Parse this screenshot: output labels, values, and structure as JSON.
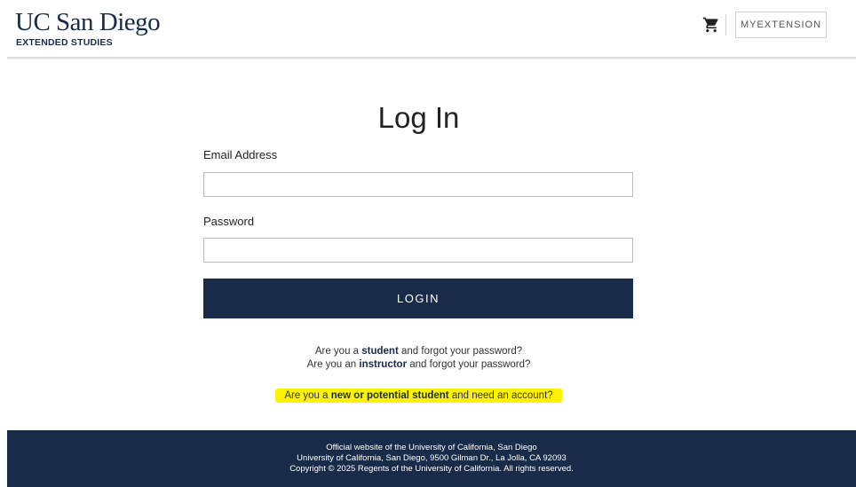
{
  "header": {
    "logo_main": "UC San Diego",
    "logo_sub": "EXTENDED STUDIES",
    "cart_icon": "shopping-cart-icon",
    "myextension_label": "MYEXTENSION"
  },
  "main": {
    "title": "Log In",
    "email_label": "Email Address",
    "email_value": "",
    "password_label": "Password",
    "password_value": "",
    "login_label": "LOGIN"
  },
  "help": {
    "line1_prefix": "Are you a",
    "line1_link": "student",
    "line1_suffix": "and forgot your password?",
    "line2_prefix": "Are you an",
    "line2_link": "instructor",
    "line2_suffix": "and forgot your password?",
    "line3_prefix": "Are you a",
    "line3_link": "new or potential student",
    "line3_suffix": "and need an account?"
  },
  "footer": {
    "line1": "Official website of the University of California, San Diego",
    "line2": "University of California, San Diego, 9500 Gilman Dr., La Jolla, CA 92093",
    "line3": "Copyright © 2025 Regents of the University of California. All rights reserved."
  },
  "colors": {
    "brand_navy": "#182b49",
    "highlight": "#fff200"
  }
}
